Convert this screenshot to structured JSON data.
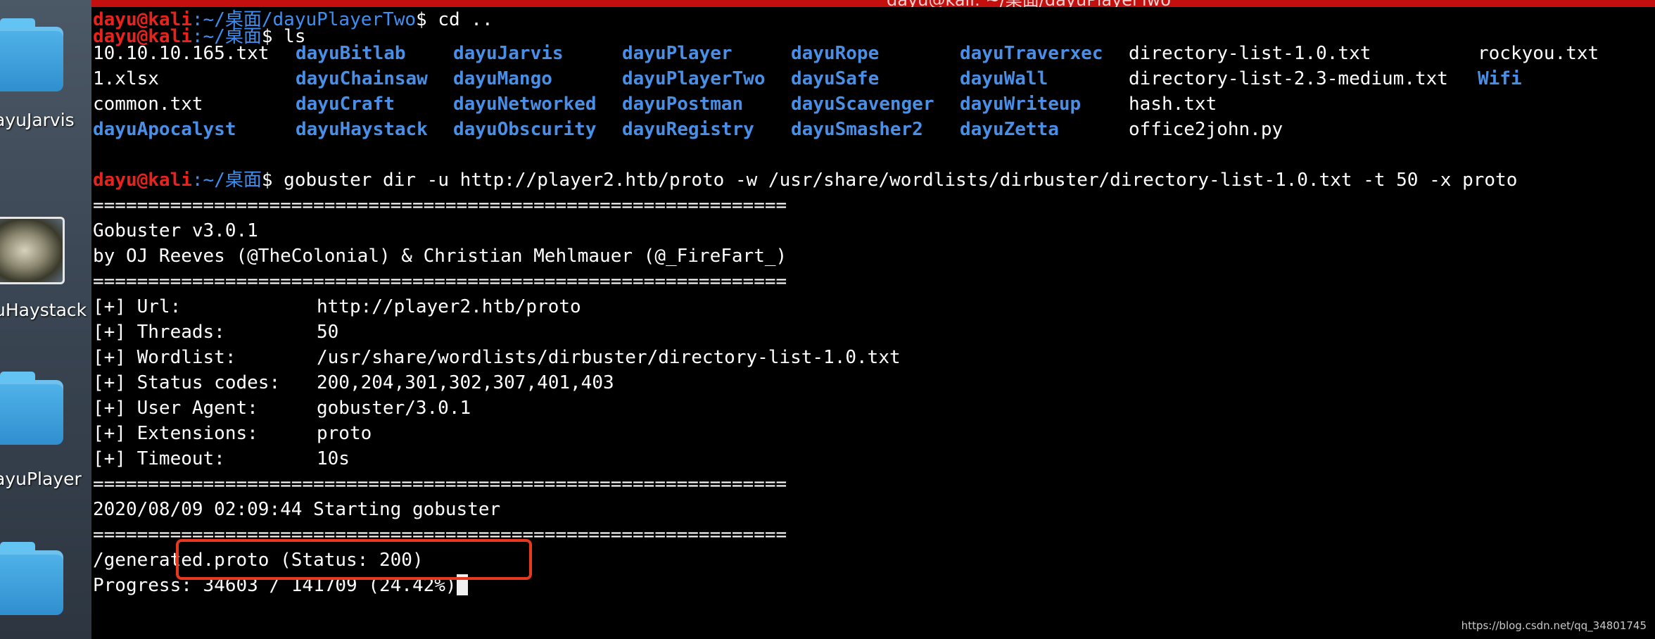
{
  "window": {
    "title": "dayu@kali: ~/桌面/dayuPlayerTwo"
  },
  "desktop": {
    "icons": [
      {
        "label": "ayuJarvis"
      },
      {
        "label": "uHaystack"
      },
      {
        "label": "ayuPlayer"
      },
      {
        "label": ""
      }
    ]
  },
  "terminal": {
    "user": "dayu@kali",
    "sep": ":",
    "path_desktop": "~/桌面",
    "path_player_two": "~/桌面/dayuPlayerTwo",
    "dollar": "$",
    "cmd_cd": " cd ..",
    "cmd_ls": " ls",
    "cmd_gobuster": " gobuster dir -u http://player2.htb/proto -w /usr/share/wordlists/dirbuster/directory-list-1.0.txt -t 50 -x proto",
    "ls_rows": [
      [
        {
          "text": "10.10.10.165.txt",
          "dir": false
        },
        {
          "text": "dayuBitlab",
          "dir": true
        },
        {
          "text": "dayuJarvis",
          "dir": true
        },
        {
          "text": "dayuPlayer",
          "dir": true
        },
        {
          "text": "dayuRope",
          "dir": true
        },
        {
          "text": "dayuTraverxec",
          "dir": true
        },
        {
          "text": "directory-list-1.0.txt",
          "dir": false
        },
        {
          "text": "rockyou.txt",
          "dir": false
        }
      ],
      [
        {
          "text": "1.xlsx",
          "dir": false
        },
        {
          "text": "dayuChainsaw",
          "dir": true
        },
        {
          "text": "dayuMango",
          "dir": true
        },
        {
          "text": "dayuPlayerTwo",
          "dir": true
        },
        {
          "text": "dayuSafe",
          "dir": true
        },
        {
          "text": "dayuWall",
          "dir": true
        },
        {
          "text": "directory-list-2.3-medium.txt",
          "dir": false
        },
        {
          "text": "Wifi",
          "dir": true
        }
      ],
      [
        {
          "text": "common.txt",
          "dir": false
        },
        {
          "text": "dayuCraft",
          "dir": true
        },
        {
          "text": "dayuNetworked",
          "dir": true
        },
        {
          "text": "dayuPostman",
          "dir": true
        },
        {
          "text": "dayuScavenger",
          "dir": true
        },
        {
          "text": "dayuWriteup",
          "dir": true
        },
        {
          "text": "hash.txt",
          "dir": false
        },
        {
          "text": "",
          "dir": false
        }
      ],
      [
        {
          "text": "dayuApocalyst",
          "dir": true
        },
        {
          "text": "dayuHaystack",
          "dir": true
        },
        {
          "text": "dayuObscurity",
          "dir": true
        },
        {
          "text": "dayuRegistry",
          "dir": true
        },
        {
          "text": "dayuSmasher2",
          "dir": true
        },
        {
          "text": "dayuZetta",
          "dir": true
        },
        {
          "text": "office2john.py",
          "dir": false
        },
        {
          "text": "",
          "dir": false
        }
      ]
    ],
    "separator": "===============================================================",
    "banner_version": "Gobuster v3.0.1",
    "banner_by": "by OJ Reeves (@TheColonial) & Christian Mehlmauer (@_FireFart_)",
    "info": [
      {
        "key": "[+] Url:",
        "value": "http://player2.htb/proto"
      },
      {
        "key": "[+] Threads:",
        "value": "50"
      },
      {
        "key": "[+] Wordlist:",
        "value": "/usr/share/wordlists/dirbuster/directory-list-1.0.txt"
      },
      {
        "key": "[+] Status codes:",
        "value": "200,204,301,302,307,401,403"
      },
      {
        "key": "[+] User Agent:",
        "value": "gobuster/3.0.1"
      },
      {
        "key": "[+] Extensions:",
        "value": "proto"
      },
      {
        "key": "[+] Timeout:",
        "value": "10s"
      }
    ],
    "start_line": "2020/08/09 02:09:44 Starting gobuster",
    "result_line": "/generated.proto (Status: 200)",
    "progress_line": "Progress: 34603 / 141709 (24.42%)",
    "progress": {
      "done": 34603,
      "total": 141709,
      "percent": 24.42
    }
  },
  "watermark": "https://blog.csdn.net/qq_34801745",
  "colors": {
    "prompt_user": "#e8231d",
    "prompt_path": "#3f8ff2",
    "directory": "#4a8fe6",
    "highlight": "#e8391f",
    "titlebar": "#c40f0f"
  }
}
